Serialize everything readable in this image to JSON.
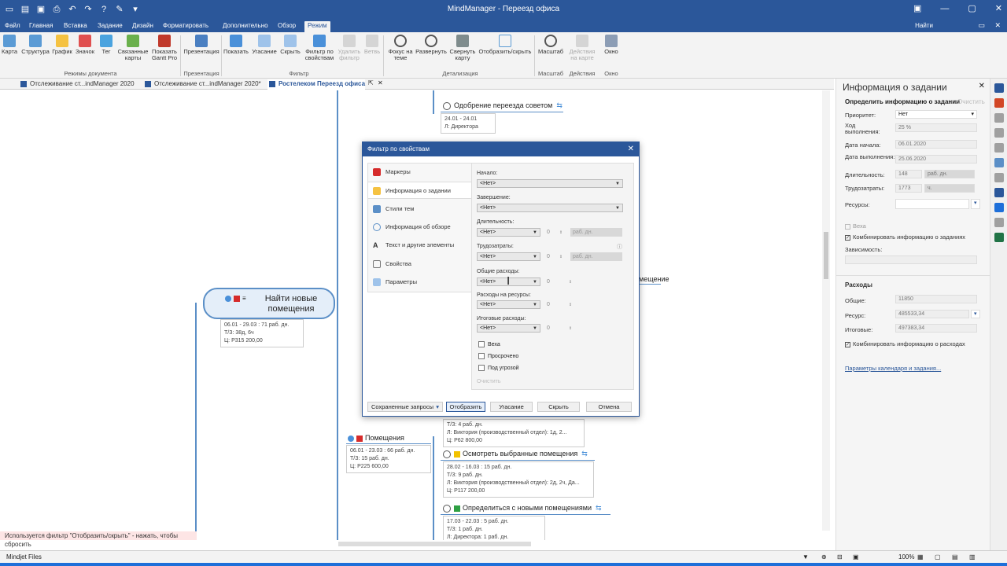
{
  "app": {
    "title": "MindManager - Переезд офиса",
    "sign_in": "Найти"
  },
  "menu_tabs": [
    "Файл",
    "Главная",
    "Вставка",
    "Задание",
    "Дизайн",
    "Форматировать",
    "Дополнительно",
    "Обзор",
    "Режим"
  ],
  "ribbon": {
    "buttons": [
      {
        "label": "Карта",
        "icon": "map-view-icon"
      },
      {
        "label": "Структура",
        "icon": "outline-view-icon"
      },
      {
        "label": "График",
        "icon": "schedule-icon"
      },
      {
        "label": "Значок",
        "icon": "icon-view-icon"
      },
      {
        "label": "Тег",
        "icon": "tag-icon"
      },
      {
        "label": "Связанные карты",
        "icon": "linked-maps-icon"
      },
      {
        "label": "Показать Gantt Pro",
        "icon": "gantt-icon"
      },
      {
        "label": "Презентация",
        "icon": "presentation-icon"
      },
      {
        "label": "Показать",
        "icon": "filter-show-icon"
      },
      {
        "label": "Угасание",
        "icon": "filter-fade-icon"
      },
      {
        "label": "Скрыть",
        "icon": "filter-hide-icon"
      },
      {
        "label": "Фильтр по свойствам",
        "icon": "filter-properties-icon"
      },
      {
        "label": "Удалить фильтр",
        "icon": "remove-filter-icon"
      },
      {
        "label": "Ветвь",
        "icon": "branch-icon"
      },
      {
        "label": "Фокус на теме",
        "icon": "focus-icon"
      },
      {
        "label": "Развернуть",
        "icon": "expand-icon"
      },
      {
        "label": "Свернуть карту",
        "icon": "collapse-icon"
      },
      {
        "label": "Отобразить/скрыть",
        "icon": "show-hide-icon"
      },
      {
        "label": "Масштаб",
        "icon": "zoom-icon"
      },
      {
        "label": "Действия на карте",
        "icon": "map-actions-icon"
      },
      {
        "label": "Окно",
        "icon": "window-icon"
      }
    ],
    "groups": [
      "Режимы документа",
      "Презентация",
      "Фильтр",
      "Детализация",
      "Масштаб",
      "Действия",
      "Окно"
    ]
  },
  "doc_tabs": [
    "Отслеживание ст...indManager 2020",
    "Отслеживание ст...indManager 2020*",
    "Ростелеком  Переезд офиса"
  ],
  "canvas": {
    "top_topic": "Одобрение переезда советом",
    "top_info": [
      "24.01 - 24.01",
      "Л: Директора"
    ],
    "central_topic": "Найти новые помещения",
    "central_info": [
      "06.01 - 29.03 : 71 раб. дн.",
      "Т/З: 38д, 6ч",
      "Ц: Р315 200,00"
    ],
    "partial_topic": "мещение",
    "topic_rooms": "Помещения",
    "rooms_info": [
      "06.01 - 23.03 : 66 раб. дн.",
      "Т/З: 15 раб. дн.",
      "Ц: Р225 600,00"
    ],
    "upper_info": [
      "Т/З: 4 раб. дн.",
      "Л: Виктория (производственный отдел): 1д, 2...",
      "Ц: Р62 800,00"
    ],
    "topic_view": "Осмотреть выбранные помещения",
    "view_info": [
      "28.02 - 16.03 : 15 раб. дн.",
      "Т/З: 9 раб. дн.",
      "Л: Виктория (производственный отдел): 2д, 2ч, Да...",
      "Ц: Р117 200,00"
    ],
    "topic_decide": "Определиться с новыми помещениями",
    "decide_info": [
      "17.03 - 22.03 : 5 раб. дн.",
      "Т/З: 1 раб. дн.",
      "Л: Директора: 1 раб. дн."
    ]
  },
  "filter_note": "Используется фильтр \"Отобразить/скрыть\" - нажать, чтобы сбросить",
  "status": {
    "mindjet": "Mindjet Files",
    "zoom": "100%"
  },
  "dialog": {
    "title": "Фильтр по свойствам",
    "nav": [
      "Маркеры",
      "Информация о задании",
      "Стили тем",
      "Информация об обзоре",
      "Текст и другие элементы",
      "Свойства",
      "Параметры"
    ],
    "fields": {
      "start_label": "Начало:",
      "start_value": "<Нет>",
      "end_label": "Завершение:",
      "end_value": "<Нет>",
      "duration_label": "Длительность:",
      "duration_value": "<Нет>",
      "duration_num": "0",
      "duration_unit": "раб. дн.",
      "effort_label": "Трудозатраты:",
      "effort_value": "<Нет>",
      "effort_num": "0",
      "effort_unit": "раб. дн.",
      "total_label": "Общие расходы:",
      "total_value": "<Нет>",
      "total_num": "0",
      "resource_label": "Расходы на ресурсы:",
      "resource_value": "<Нет>",
      "resource_num": "0",
      "final_label": "Итоговые расходы:",
      "final_value": "<Нет>",
      "final_num": "0"
    },
    "checks": [
      "Веха",
      "Просрочено",
      "Под угрозой"
    ],
    "clear": "Очистить",
    "buttons": {
      "saved": "Сохраненные запросы",
      "show": "Отобразить",
      "fade": "Угасание",
      "hide": "Скрыть",
      "cancel": "Отмена"
    }
  },
  "task_panel": {
    "title": "Информация о задании",
    "subtitle": "Определить информацию о задании",
    "subtitle_link": "Очистить",
    "priority_label": "Приоритет:",
    "priority_value": "Нет",
    "progress_label": "Ход выполнения:",
    "progress_value": "25 %",
    "start_label": "Дата начала:",
    "start_value": "06.01.2020",
    "due_label": "Дата выполнения:",
    "due_value": "25.06.2020",
    "duration_label": "Длительность:",
    "duration_value": "148",
    "duration_unit": "раб. дн.",
    "effort_label": "Трудозатраты:",
    "effort_value": "1773",
    "effort_unit": "ч.",
    "resources_label": "Ресурсы:",
    "milestone": "Веха",
    "combine_tasks": "Комбинировать информацию о заданиях",
    "dependency_label": "Зависимость:",
    "costs_header": "Расходы",
    "total_label": "Общие:",
    "total_value": "11850",
    "resource_label": "Ресурс:",
    "resource_value": "485533,34",
    "final_label": "Итоговые:",
    "final_value": "497383,34",
    "combine_costs": "Комбинировать информацию о расходах",
    "calendar_link": "Параметры календаря и задания..."
  },
  "colors": {
    "brand": "#2b579a",
    "accent_blue": "#1e6fd9",
    "topic_outline": "#5b8fc7"
  }
}
